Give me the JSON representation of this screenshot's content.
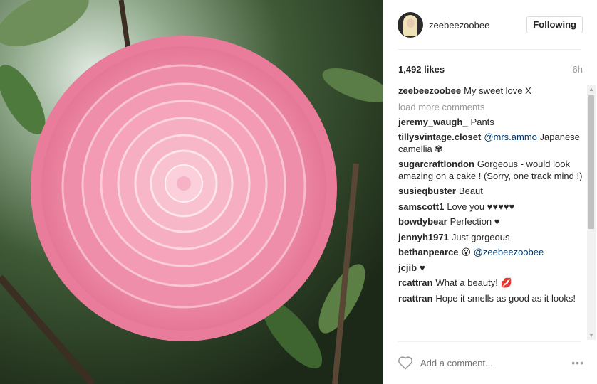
{
  "post": {
    "username": "zeebeezoobee",
    "follow_label": "Following",
    "likes": "1,492 likes",
    "time": "6h",
    "caption": {
      "author": "zeebeezoobee",
      "text": "My sweet love X"
    },
    "load_more": "load more comments",
    "comments": [
      {
        "author": "jeremy_waugh_",
        "text": "Pants",
        "mention": "",
        "after": ""
      },
      {
        "author": "tillysvintage.closet",
        "text": "",
        "mention": "@mrs.ammo",
        "after": " Japanese camellia ✾"
      },
      {
        "author": "sugarcraftlondon",
        "text": "Gorgeous - would look amazing on a cake ! (Sorry, one track mind !)",
        "mention": "",
        "after": ""
      },
      {
        "author": "susieqbuster",
        "text": "Beaut",
        "mention": "",
        "after": ""
      },
      {
        "author": "samscott1",
        "text": "Love you ♥♥♥♥♥",
        "mention": "",
        "after": ""
      },
      {
        "author": "bowdybear",
        "text": "Perfection ♥",
        "mention": "",
        "after": ""
      },
      {
        "author": "jennyh1971",
        "text": "Just gorgeous",
        "mention": "",
        "after": ""
      },
      {
        "author": "bethanpearce",
        "text": "😮",
        "mention": "@zeebeezoobee",
        "after": ""
      },
      {
        "author": "jcjib",
        "text": "♥",
        "mention": "",
        "after": ""
      },
      {
        "author": "rcattran",
        "text": "What a beauty! 💋",
        "mention": "",
        "after": ""
      },
      {
        "author": "rcattran",
        "text": "Hope it smells as good as it looks!",
        "mention": "",
        "after": ""
      }
    ],
    "add_comment_placeholder": "Add a comment...",
    "more_label": "•••"
  },
  "icons": {
    "heart": "heart-outline-icon",
    "more": "more-options-icon"
  },
  "colors": {
    "mention": "#003569",
    "muted": "#999999",
    "flower": "#f08aa6"
  }
}
